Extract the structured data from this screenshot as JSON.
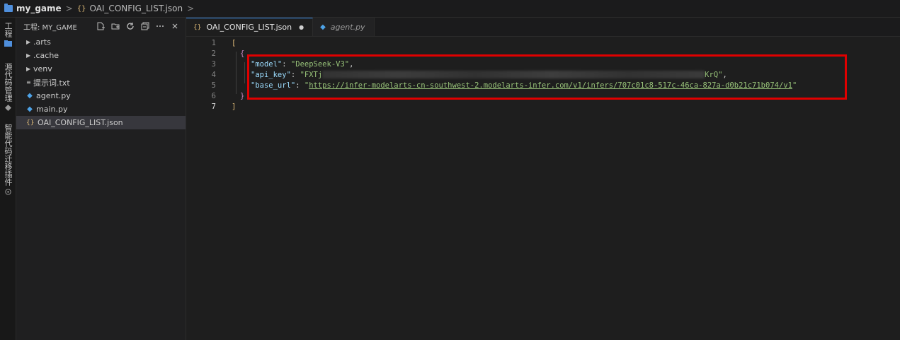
{
  "breadcrumb": {
    "project": "my_game",
    "separator": ">",
    "file_glyph": "{}",
    "file": "OAI_CONFIG_LIST.json",
    "trailing": ">"
  },
  "activity_bar": {
    "items": [
      {
        "label": "工程",
        "icon": "folder-icon"
      },
      {
        "label": "源代码管理",
        "icon": "source-control-icon"
      },
      {
        "label": "智能代码迁移插件",
        "icon": "migration-icon"
      }
    ]
  },
  "sidebar": {
    "title": "工程: MY_GAME",
    "actions": [
      "new-file-icon",
      "new-folder-icon",
      "refresh-icon",
      "collapse-icon",
      "more-icon",
      "close-icon"
    ],
    "items": [
      {
        "label": ".arts",
        "type": "folder"
      },
      {
        "label": ".cache",
        "type": "folder"
      },
      {
        "label": "venv",
        "type": "folder"
      },
      {
        "label": "提示词.txt",
        "type": "txt"
      },
      {
        "label": "agent.py",
        "type": "py"
      },
      {
        "label": "main.py",
        "type": "py"
      },
      {
        "label": "OAI_CONFIG_LIST.json",
        "type": "json",
        "selected": true
      }
    ]
  },
  "tabs": [
    {
      "label": "OAI_CONFIG_LIST.json",
      "active": true,
      "modified_marker": "●"
    },
    {
      "label": "agent.py",
      "active": false
    }
  ],
  "code": {
    "line_numbers": [
      "1",
      "2",
      "3",
      "4",
      "5",
      "6",
      "7"
    ],
    "open_bracket": "[",
    "open_brace": "{",
    "model_key": "\"model\"",
    "model_value": "\"DeepSeek-V3\"",
    "api_key_key": "\"api_key\"",
    "api_key_prefix": "\"FXTj",
    "api_key_suffix": "KrQ\"",
    "base_url_key": "\"base_url\"",
    "base_url_value": "https://infer-modelarts-cn-southwest-2.modelarts-infer.com/v1/infers/707c01c8-517c-46ca-827a-d0b21c71b074/v1",
    "close_brace": "}",
    "close_bracket": "]"
  },
  "colors": {
    "highlight_box": "#e00000",
    "accent": "#3b8eea"
  }
}
